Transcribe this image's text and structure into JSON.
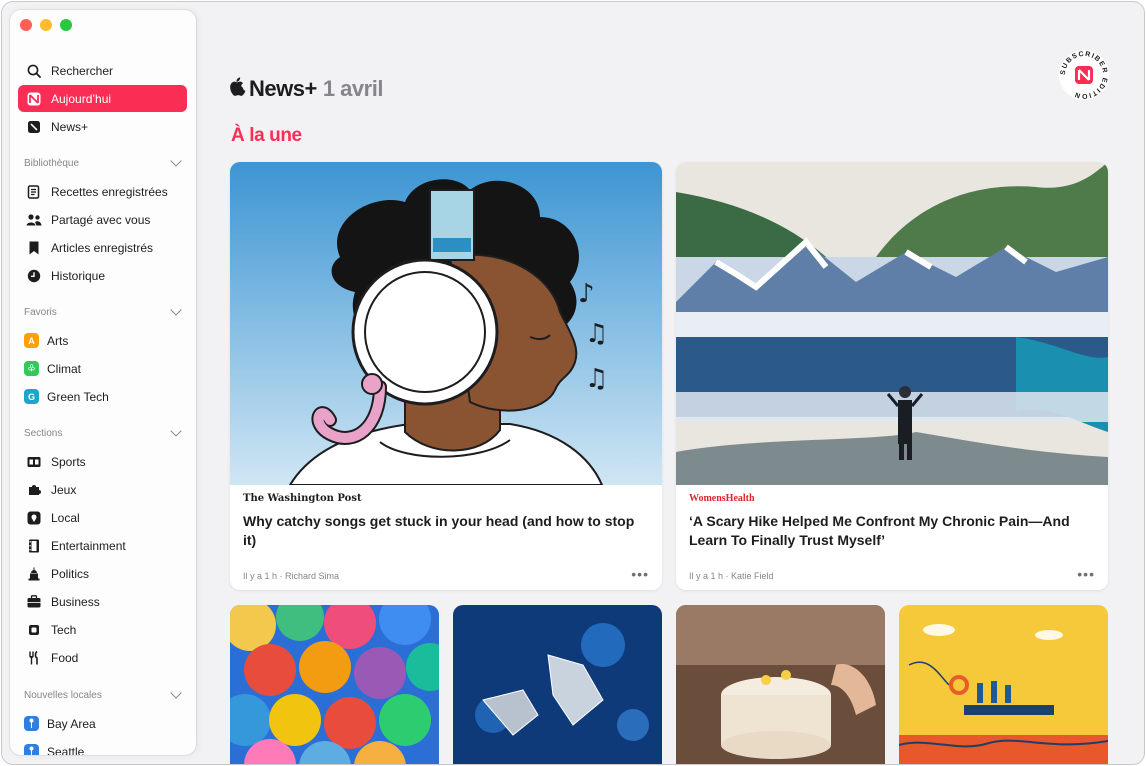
{
  "sidebar": {
    "top_items": [
      {
        "label": "Rechercher",
        "icon": "search-icon"
      },
      {
        "label": "Aujourd’hui",
        "icon": "news-icon"
      },
      {
        "label": "News+",
        "icon": "news-plus-icon"
      }
    ],
    "library": {
      "heading": "Bibliothèque",
      "items": [
        {
          "label": "Recettes enregistrées",
          "icon": "recipes-icon"
        },
        {
          "label": "Partagé avec vous",
          "icon": "shared-icon"
        },
        {
          "label": "Articles enregistrés",
          "icon": "bookmark-icon"
        },
        {
          "label": "Historique",
          "icon": "clock-icon"
        }
      ]
    },
    "favorites": {
      "heading": "Favoris",
      "items": [
        {
          "label": "Arts",
          "letter": "A",
          "color": "#ff9f0a"
        },
        {
          "label": "Climat",
          "letter": "♧",
          "color": "#34c759"
        },
        {
          "label": "Green Tech",
          "letter": "G",
          "color": "#1ba7c9"
        }
      ]
    },
    "sections": {
      "heading": "Sections",
      "items": [
        {
          "label": "Sports",
          "icon": "scoreboard-icon"
        },
        {
          "label": "Jeux",
          "icon": "puzzle-icon"
        },
        {
          "label": "Local",
          "icon": "location-icon"
        },
        {
          "label": "Entertainment",
          "icon": "film-icon"
        },
        {
          "label": "Politics",
          "icon": "capitol-icon"
        },
        {
          "label": "Business",
          "icon": "briefcase-icon"
        },
        {
          "label": "Tech",
          "icon": "chip-icon"
        },
        {
          "label": "Food",
          "icon": "fork-knife-icon"
        }
      ]
    },
    "local_news": {
      "heading": "Nouvelles locales",
      "items": [
        {
          "label": "Bay Area",
          "color": "#2f7fe0"
        },
        {
          "label": "Seattle",
          "color": "#2f7fe0"
        }
      ]
    }
  },
  "header": {
    "brand": "News+",
    "date": "1 avril",
    "section": "À la une",
    "badge_text": "SUBSCRIBER EDITION"
  },
  "featured": [
    {
      "publication": "The Washington Post",
      "headline": "Why catchy songs get stuck in your head (and how to stop it)",
      "meta": "Il y a 1 h · Richard Sima"
    },
    {
      "publication": "WomensHealth",
      "headline": "‘A Scary Hike Helped Me Confront My Chronic Pain—And Learn To Finally Trust Myself’",
      "meta": "Il y a 1 h · Katie Field"
    }
  ],
  "more_label": "•••",
  "colors": {
    "accent": "#fa2d55",
    "secondary_text": "#86868b"
  }
}
